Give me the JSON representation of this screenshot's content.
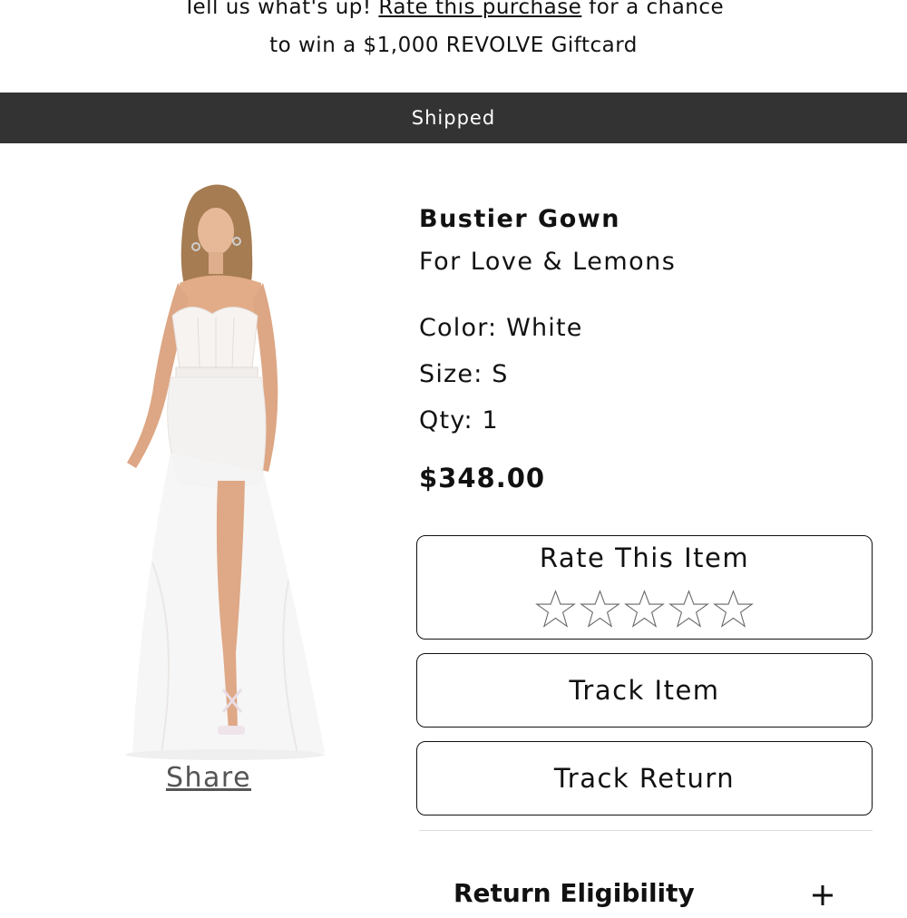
{
  "promo": {
    "prefix": "Tell us what's up!",
    "link": "Rate this purchase",
    "suffix": "for a chance",
    "line2": "to win a $1,000 REVOLVE Giftcard"
  },
  "status": {
    "label": "Shipped",
    "bar_color": "#333333"
  },
  "product": {
    "name": "Bustier Gown",
    "brand": "For Love & Lemons",
    "color": "Color: White",
    "size": "Size: S",
    "qty": "Qty: 1",
    "price": "$348.00",
    "image_alt": "Model wearing white bustier gown"
  },
  "share": {
    "label": "Share"
  },
  "rating": {
    "label": "Rate This Item",
    "current": 0,
    "max": 5,
    "icon": "star-outline-icon"
  },
  "actions": {
    "track_item": "Track Item",
    "track_return": "Track Return"
  },
  "return_eligibility": {
    "label": "Return Eligibility",
    "icon": "plus-icon"
  }
}
